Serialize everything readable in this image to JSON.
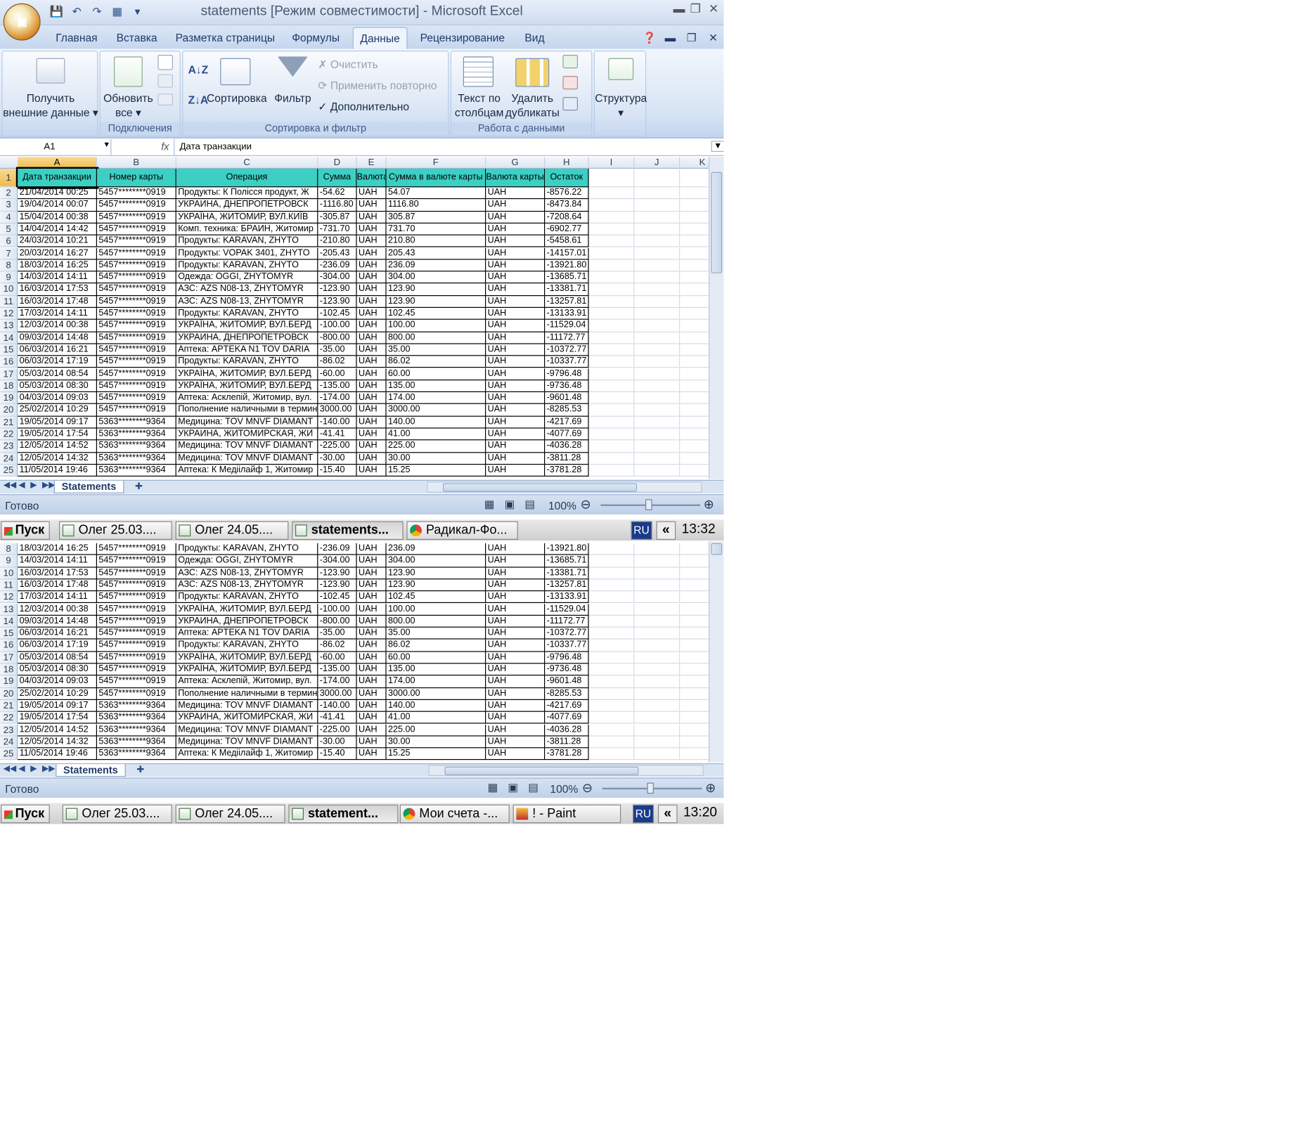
{
  "top": {
    "title": "statements  [Режим совместимости] - Microsoft Excel",
    "tabs": [
      "Главная",
      "Вставка",
      "Разметка страницы",
      "Формулы",
      "Данные",
      "Рецензирование",
      "Вид"
    ],
    "active_tab": "Данные",
    "ribbon": {
      "get_external": [
        "Получить",
        "внешние данные"
      ],
      "refresh": [
        "Обновить",
        "все"
      ],
      "connections_group": "Подключения",
      "sort": "Сортировка",
      "filter": "Фильтр",
      "clear": "Очистить",
      "reapply": "Применить повторно",
      "advanced": "Дополнительно",
      "sort_filter_group": "Сортировка и фильтр",
      "text_to_cols": [
        "Текст по",
        "столбцам"
      ],
      "remove_dups": [
        "Удалить",
        "дубликаты"
      ],
      "data_tools_group": "Работа с данными",
      "outline": "Структура"
    },
    "name_box": "A1",
    "fx": "fx",
    "formula": "Дата транзакции",
    "columns": [
      "A",
      "B",
      "C",
      "D",
      "E",
      "F",
      "G",
      "H",
      "I",
      "J",
      "K"
    ],
    "headers": [
      "Дата транзакции",
      "Номер карты",
      "Операция",
      "Сумма",
      "Валюта",
      "Сумма в валюте карты",
      "Валюта карты",
      "Остаток"
    ],
    "rows": [
      [
        "2",
        "21/04/2014 00:25",
        "5457********0919",
        "Продукты: К Полісся продукт, Ж",
        "-54.62",
        "UAH",
        "54.07",
        "UAH",
        "-8576.22"
      ],
      [
        "3",
        "19/04/2014 00:07",
        "5457********0919",
        "УКРАИНА, ДНЕПРОПЕТРОВСК",
        "-1116.80",
        "UAH",
        "1116.80",
        "UAH",
        "-8473.84"
      ],
      [
        "4",
        "15/04/2014 00:38",
        "5457********0919",
        "УКРАЇНА, ЖИТОМИР, ВУЛ.КИЇВ",
        "-305.87",
        "UAH",
        "305.87",
        "UAH",
        "-7208.64"
      ],
      [
        "5",
        "14/04/2014 14:42",
        "5457********0919",
        "Комп. техника: БРАИН, Житомир",
        "-731.70",
        "UAH",
        "731.70",
        "UAH",
        "-6902.77"
      ],
      [
        "6",
        "24/03/2014 10:21",
        "5457********0919",
        "Продукты: KARAVAN, ZHYTO",
        "-210.80",
        "UAH",
        "210.80",
        "UAH",
        "-5458.61"
      ],
      [
        "7",
        "20/03/2014 16:27",
        "5457********0919",
        "Продукты: VOPAK 3401, ZHYTO",
        "-205.43",
        "UAH",
        "205.43",
        "UAH",
        "-14157.01"
      ],
      [
        "8",
        "18/03/2014 16:25",
        "5457********0919",
        "Продукты: KARAVAN, ZHYTO",
        "-236.09",
        "UAH",
        "236.09",
        "UAH",
        "-13921.80"
      ],
      [
        "9",
        "14/03/2014 14:11",
        "5457********0919",
        "Одежда: OGGI, ZHYTOMYR",
        "-304.00",
        "UAH",
        "304.00",
        "UAH",
        "-13685.71"
      ],
      [
        "10",
        "16/03/2014 17:53",
        "5457********0919",
        "АЗС: AZS N08-13, ZHYTOMYR",
        "-123.90",
        "UAH",
        "123.90",
        "UAH",
        "-13381.71"
      ],
      [
        "11",
        "16/03/2014 17:48",
        "5457********0919",
        "АЗС: AZS N08-13, ZHYTOMYR",
        "-123.90",
        "UAH",
        "123.90",
        "UAH",
        "-13257.81"
      ],
      [
        "12",
        "17/03/2014 14:11",
        "5457********0919",
        "Продукты: KARAVAN, ZHYTO",
        "-102.45",
        "UAH",
        "102.45",
        "UAH",
        "-13133.91"
      ],
      [
        "13",
        "12/03/2014 00:38",
        "5457********0919",
        "УКРАЇНА, ЖИТОМИР, ВУЛ.БЕРД",
        "-100.00",
        "UAH",
        "100.00",
        "UAH",
        "-11529.04"
      ],
      [
        "14",
        "09/03/2014 14:48",
        "5457********0919",
        "УКРАИНА, ДНЕПРОПЕТРОВСК",
        "-800.00",
        "UAH",
        "800.00",
        "UAH",
        "-11172.77"
      ],
      [
        "15",
        "06/03/2014 16:21",
        "5457********0919",
        "Аптека: APTEKA N1 TOV DARIA",
        "-35.00",
        "UAH",
        "35.00",
        "UAH",
        "-10372.77"
      ],
      [
        "16",
        "06/03/2014 17:19",
        "5457********0919",
        "Продукты: KARAVAN, ZHYTO",
        "-86.02",
        "UAH",
        "86.02",
        "UAH",
        "-10337.77"
      ],
      [
        "17",
        "05/03/2014 08:54",
        "5457********0919",
        "УКРАЇНА, ЖИТОМИР, ВУЛ.БЕРД",
        "-60.00",
        "UAH",
        "60.00",
        "UAH",
        "-9796.48"
      ],
      [
        "18",
        "05/03/2014 08:30",
        "5457********0919",
        "УКРАЇНА, ЖИТОМИР, ВУЛ.БЕРД",
        "-135.00",
        "UAH",
        "135.00",
        "UAH",
        "-9736.48"
      ],
      [
        "19",
        "04/03/2014 09:03",
        "5457********0919",
        "Аптека: Асклепій, Житомир, вул.",
        "-174.00",
        "UAH",
        "174.00",
        "UAH",
        "-9601.48"
      ],
      [
        "20",
        "25/02/2014 10:29",
        "5457********0919",
        "Пополнение наличными в термин",
        "3000.00",
        "UAH",
        "3000.00",
        "UAH",
        "-8285.53"
      ],
      [
        "21",
        "19/05/2014 09:17",
        "5363********9364",
        "Медицина: TOV MNVF DIAMANT",
        "-140.00",
        "UAH",
        "140.00",
        "UAH",
        "-4217.69"
      ],
      [
        "22",
        "19/05/2014 17:54",
        "5363********9364",
        "УКРАИНА, ЖИТОМИРСКАЯ, ЖИ",
        "-41.41",
        "UAH",
        "41.00",
        "UAH",
        "-4077.69"
      ],
      [
        "23",
        "12/05/2014 14:52",
        "5363********9364",
        "Медицина: TOV MNVF DIAMANT",
        "-225.00",
        "UAH",
        "225.00",
        "UAH",
        "-4036.28"
      ],
      [
        "24",
        "12/05/2014 14:32",
        "5363********9364",
        "Медицина: TOV MNVF DIAMANT",
        "-30.00",
        "UAH",
        "30.00",
        "UAH",
        "-3811.28"
      ],
      [
        "25",
        "11/05/2014 19:46",
        "5363********9364",
        "Аптека: К Медіілайф 1, Житомир",
        "-15.40",
        "UAH",
        "15.25",
        "UAH",
        "-3781.28"
      ]
    ],
    "sheet_tab": "Statements",
    "status": "Готово",
    "zoom": "100%",
    "taskbar": {
      "start": "Пуск",
      "items": [
        "Олег 25.03....",
        "Олег 24.05....",
        "statements...",
        "Радикал-Фо..."
      ],
      "lang": "RU",
      "arrows": "«",
      "clock": "13:32"
    }
  },
  "bottom": {
    "rows": [
      [
        "8",
        "18/03/2014 16:25",
        "5457********0919",
        "Продукты: KARAVAN, ZHYTO",
        "-236.09",
        "UAH",
        "236.09",
        "UAH",
        "-13921.80"
      ],
      [
        "9",
        "14/03/2014 14:11",
        "5457********0919",
        "Одежда: OGGI, ZHYTOMYR",
        "-304.00",
        "UAH",
        "304.00",
        "UAH",
        "-13685.71"
      ],
      [
        "10",
        "16/03/2014 17:53",
        "5457********0919",
        "АЗС: AZS N08-13, ZHYTOMYR",
        "-123.90",
        "UAH",
        "123.90",
        "UAH",
        "-13381.71"
      ],
      [
        "11",
        "16/03/2014 17:48",
        "5457********0919",
        "АЗС: AZS N08-13, ZHYTOMYR",
        "-123.90",
        "UAH",
        "123.90",
        "UAH",
        "-13257.81"
      ],
      [
        "12",
        "17/03/2014 14:11",
        "5457********0919",
        "Продукты: KARAVAN, ZHYTO",
        "-102.45",
        "UAH",
        "102.45",
        "UAH",
        "-13133.91"
      ],
      [
        "13",
        "12/03/2014 00:38",
        "5457********0919",
        "УКРАЇНА, ЖИТОМИР, ВУЛ.БЕРД",
        "-100.00",
        "UAH",
        "100.00",
        "UAH",
        "-11529.04"
      ],
      [
        "14",
        "09/03/2014 14:48",
        "5457********0919",
        "УКРАИНА, ДНЕПРОПЕТРОВСК",
        "-800.00",
        "UAH",
        "800.00",
        "UAH",
        "-11172.77"
      ],
      [
        "15",
        "06/03/2014 16:21",
        "5457********0919",
        "Аптека: APTEKA N1 TOV DARIA",
        "-35.00",
        "UAH",
        "35.00",
        "UAH",
        "-10372.77"
      ],
      [
        "16",
        "06/03/2014 17:19",
        "5457********0919",
        "Продукты: KARAVAN, ZHYTO",
        "-86.02",
        "UAH",
        "86.02",
        "UAH",
        "-10337.77"
      ],
      [
        "17",
        "05/03/2014 08:54",
        "5457********0919",
        "УКРАЇНА, ЖИТОМИР, ВУЛ.БЕРД",
        "-60.00",
        "UAH",
        "60.00",
        "UAH",
        "-9796.48"
      ],
      [
        "18",
        "05/03/2014 08:30",
        "5457********0919",
        "УКРАЇНА, ЖИТОМИР, ВУЛ.БЕРД",
        "-135.00",
        "UAH",
        "135.00",
        "UAH",
        "-9736.48"
      ],
      [
        "19",
        "04/03/2014 09:03",
        "5457********0919",
        "Аптека: Асклепій, Житомир, вул.",
        "-174.00",
        "UAH",
        "174.00",
        "UAH",
        "-9601.48"
      ],
      [
        "20",
        "25/02/2014 10:29",
        "5457********0919",
        "Пополнение наличными в термин",
        "3000.00",
        "UAH",
        "3000.00",
        "UAH",
        "-8285.53"
      ],
      [
        "21",
        "19/05/2014 09:17",
        "5363********9364",
        "Медицина: TOV MNVF DIAMANT",
        "-140.00",
        "UAH",
        "140.00",
        "UAH",
        "-4217.69"
      ],
      [
        "22",
        "19/05/2014 17:54",
        "5363********9364",
        "УКРАИНА, ЖИТОМИРСКАЯ, ЖИ",
        "-41.41",
        "UAH",
        "41.00",
        "UAH",
        "-4077.69"
      ],
      [
        "23",
        "12/05/2014 14:52",
        "5363********9364",
        "Медицина: TOV MNVF DIAMANT",
        "-225.00",
        "UAH",
        "225.00",
        "UAH",
        "-4036.28"
      ],
      [
        "24",
        "12/05/2014 14:32",
        "5363********9364",
        "Медицина: TOV MNVF DIAMANT",
        "-30.00",
        "UAH",
        "30.00",
        "UAH",
        "-3811.28"
      ],
      [
        "25",
        "11/05/2014 19:46",
        "5363********9364",
        "Аптека: К Медіілайф 1, Житомир",
        "-15.40",
        "UAH",
        "15.25",
        "UAH",
        "-3781.28"
      ]
    ],
    "sheet_tab": "Statements",
    "status": "Готово",
    "zoom": "100%",
    "taskbar": {
      "start": "Пуск",
      "items": [
        "Олег 25.03....",
        "Олег 24.05....",
        "statement...",
        "Мои счета -...",
        "! - Paint"
      ],
      "lang": "RU",
      "arrows": "«",
      "clock": "13:20"
    }
  }
}
